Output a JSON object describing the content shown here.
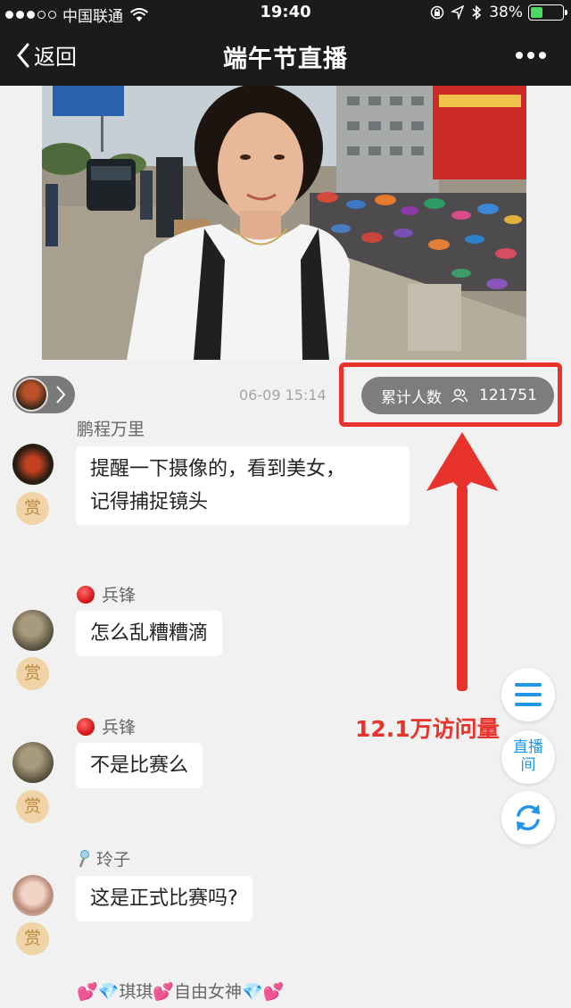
{
  "status_bar": {
    "carrier": "中国联通",
    "time": "19:40",
    "battery_percent": "38%",
    "battery_level": 0.38
  },
  "nav": {
    "back_label": "返回",
    "title": "端午节直播"
  },
  "live_info": {
    "timestamp": "06-09 15:14",
    "viewers_label": "累计人数",
    "viewers_count": "121751"
  },
  "comments": [
    {
      "name": "鹏程万里",
      "text": "提醒一下摄像的，看到美女，记得捕捉镜头",
      "line1": "提醒一下摄像的，看到美女，",
      "line2": "记得捕捉镜头",
      "reward": "赏"
    },
    {
      "name": "兵锋",
      "text": "怎么乱糟糟滴",
      "reward": "赏"
    },
    {
      "name": "兵锋",
      "text": "不是比赛么",
      "reward": "赏"
    },
    {
      "name": "玲子",
      "text": "这是正式比赛吗?",
      "reward": "赏"
    },
    {
      "name": "💕💎琪琪💕自由女神💎💕"
    }
  ],
  "annotation": {
    "text": "12.1万访问量",
    "color": "#e8322c"
  },
  "side_buttons": {
    "room_label_1": "直播",
    "room_label_2": "间"
  },
  "colors": {
    "accent_blue": "#2196e8",
    "bar_bg": "#1b1b1b",
    "page_bg": "#f1f1f1"
  }
}
